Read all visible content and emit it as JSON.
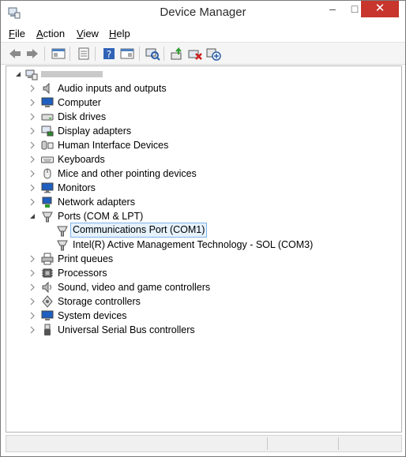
{
  "window": {
    "title": "Device Manager"
  },
  "menu": [
    {
      "label": "File",
      "accel": "F",
      "rest": "ile"
    },
    {
      "label": "Action",
      "accel": "A",
      "rest": "ction"
    },
    {
      "label": "View",
      "accel": "V",
      "rest": "iew"
    },
    {
      "label": "Help",
      "accel": "H",
      "rest": "elp"
    }
  ],
  "toolbar": {
    "icons": [
      "back-icon",
      "forward-icon",
      "show-hide-console-tree-icon",
      "properties-icon",
      "help-icon",
      "show-action-pane-icon",
      "scan-hardware-changes-icon",
      "update-driver-icon",
      "uninstall-device-icon",
      "add-legacy-hardware-icon"
    ]
  },
  "tree": {
    "root": {
      "label": "",
      "icon": "computer-root-icon",
      "expanded": true
    },
    "categories": [
      {
        "label": "Audio inputs and outputs",
        "icon": "speaker-icon",
        "expanded": false
      },
      {
        "label": "Computer",
        "icon": "computer-icon",
        "expanded": false
      },
      {
        "label": "Disk drives",
        "icon": "disk-drive-icon",
        "expanded": false
      },
      {
        "label": "Display adapters",
        "icon": "display-adapter-icon",
        "expanded": false
      },
      {
        "label": "Human Interface Devices",
        "icon": "hid-icon",
        "expanded": false
      },
      {
        "label": "Keyboards",
        "icon": "keyboard-icon",
        "expanded": false
      },
      {
        "label": "Mice and other pointing devices",
        "icon": "mouse-icon",
        "expanded": false
      },
      {
        "label": "Monitors",
        "icon": "monitor-icon",
        "expanded": false
      },
      {
        "label": "Network adapters",
        "icon": "network-adapter-icon",
        "expanded": false
      },
      {
        "label": "Ports (COM & LPT)",
        "icon": "port-icon",
        "expanded": true,
        "children": [
          {
            "label": "Communications Port (COM1)",
            "icon": "port-icon",
            "selected": true
          },
          {
            "label": "Intel(R) Active Management Technology - SOL (COM3)",
            "icon": "port-icon",
            "selected": false
          }
        ]
      },
      {
        "label": "Print queues",
        "icon": "printer-icon",
        "expanded": false
      },
      {
        "label": "Processors",
        "icon": "processor-icon",
        "expanded": false
      },
      {
        "label": "Sound, video and game controllers",
        "icon": "sound-controller-icon",
        "expanded": false
      },
      {
        "label": "Storage controllers",
        "icon": "storage-controller-icon",
        "expanded": false
      },
      {
        "label": "System devices",
        "icon": "system-devices-icon",
        "expanded": false
      },
      {
        "label": "Universal Serial Bus controllers",
        "icon": "usb-icon",
        "expanded": false
      }
    ]
  },
  "colors": {
    "close": "#c7352d",
    "selection_bg": "#e5f1fb",
    "selection_border": "#7eb4ea"
  }
}
